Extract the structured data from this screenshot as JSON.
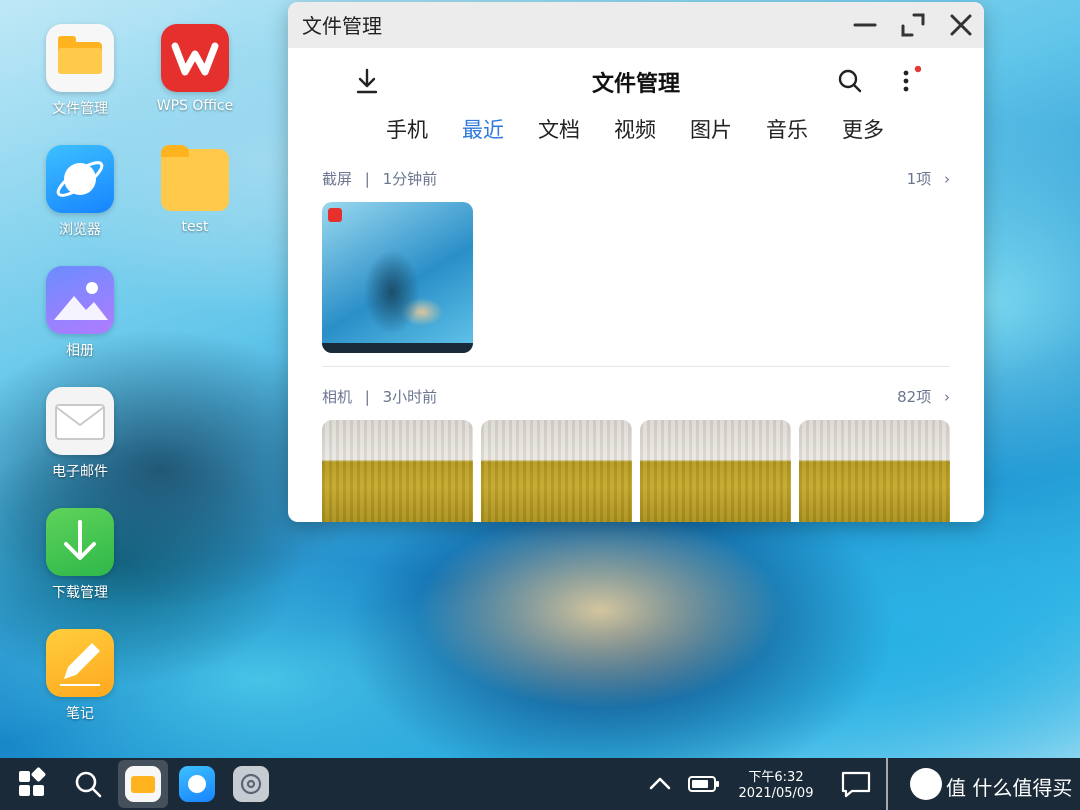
{
  "desktop": {
    "icons": [
      {
        "label": "文件管理"
      },
      {
        "label": "WPS Office"
      },
      {
        "label": "浏览器"
      },
      {
        "label": "test"
      },
      {
        "label": "相册"
      },
      {
        "label": "电子邮件"
      },
      {
        "label": "下载管理"
      },
      {
        "label": "笔记"
      }
    ]
  },
  "window": {
    "title": "文件管理",
    "app_title": "文件管理",
    "tabs": [
      {
        "label": "手机"
      },
      {
        "label": "最近",
        "active": true
      },
      {
        "label": "文档"
      },
      {
        "label": "视频"
      },
      {
        "label": "图片"
      },
      {
        "label": "音乐"
      },
      {
        "label": "更多"
      }
    ],
    "sections": [
      {
        "name": "截屏",
        "time": "1分钟前",
        "count": "1项"
      },
      {
        "name": "相机",
        "time": "3小时前",
        "count": "82项"
      }
    ]
  },
  "taskbar": {
    "time": "下午6:32",
    "date": "2021/05/09",
    "watermark": "值 什么值得买"
  },
  "colors": {
    "accent": "#2f7bdc",
    "taskbar": "#1b2a38",
    "notification_dot": "#e53935"
  }
}
